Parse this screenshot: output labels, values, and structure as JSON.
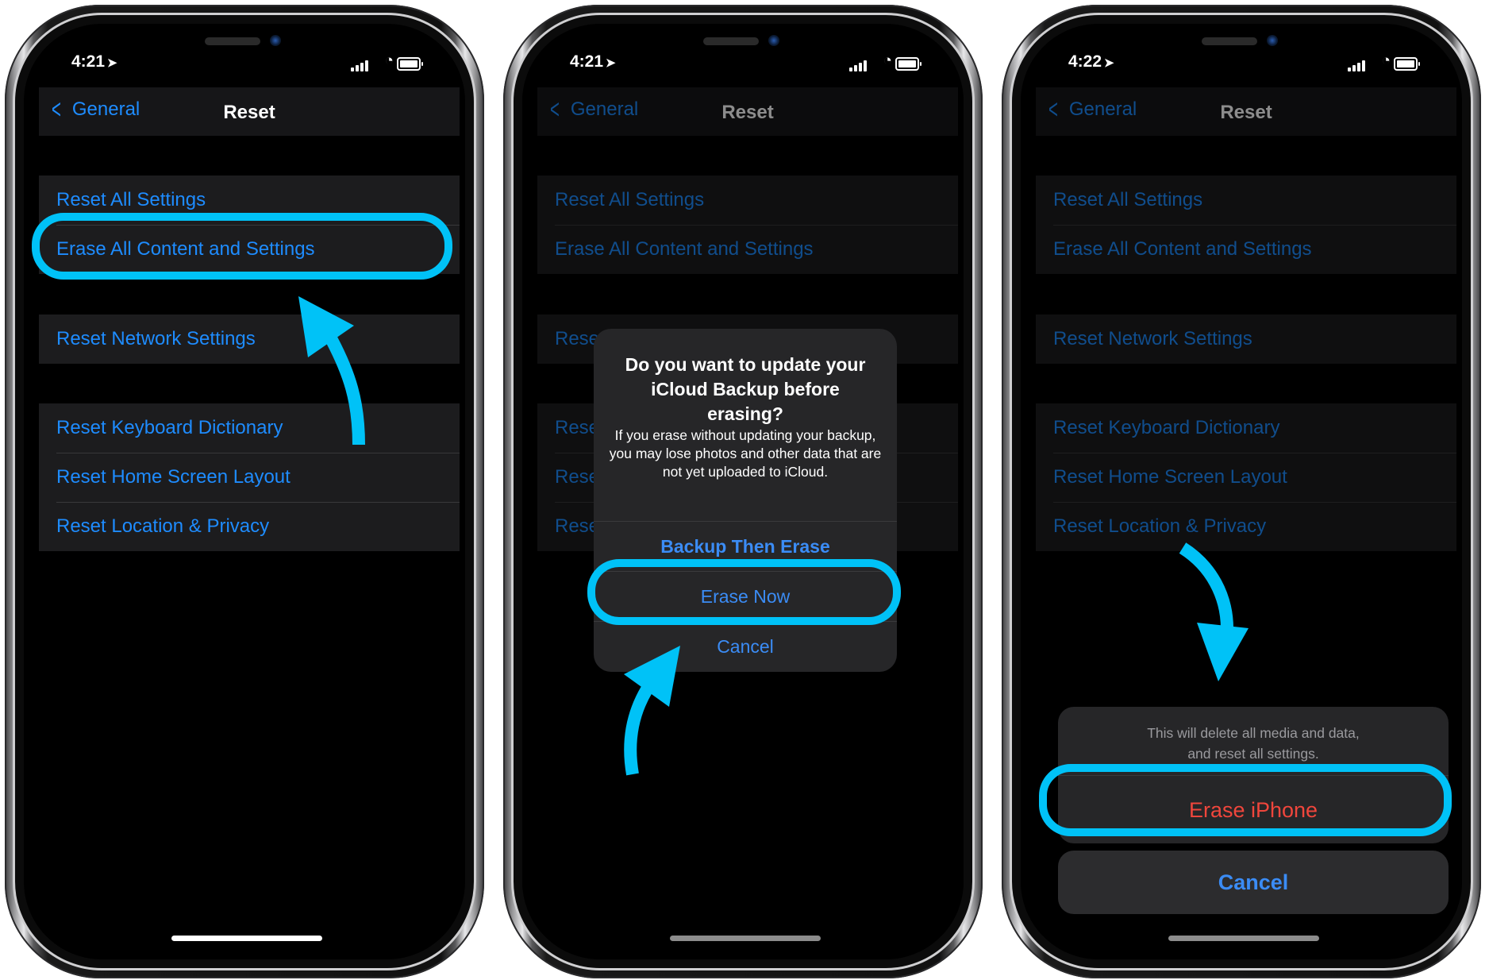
{
  "accent_color": "#00c2f7",
  "link_color": "#1e8cff",
  "destructive_color": "#f0463c",
  "phones": [
    {
      "status": {
        "time": "4:21",
        "location_icon": "location-arrow-icon",
        "signal_icon": "signal-bars-icon",
        "wifi_icon": "wifi-icon",
        "battery_icon": "battery-icon"
      },
      "nav": {
        "back_label": "General",
        "back_icon": "chevron-left-icon",
        "title": "Reset"
      },
      "groups": [
        [
          "Reset All Settings",
          "Erase All Content and Settings"
        ],
        [
          "Reset Network Settings"
        ],
        [
          "Reset Keyboard Dictionary",
          "Reset Home Screen Layout",
          "Reset Location & Privacy"
        ]
      ],
      "highlighted": "Erase All Content and Settings"
    },
    {
      "status": {
        "time": "4:21"
      },
      "nav": {
        "back_label": "General",
        "title": "Reset"
      },
      "groups": [
        [
          "Reset All Settings",
          "Erase All Content and Settings"
        ],
        [
          "Reset Network Settings"
        ],
        [
          "Reset Keyboard Dictionary",
          "Reset Home Screen Layout",
          "Reset Location & Privacy"
        ]
      ],
      "alert": {
        "title": "Do you want to update your iCloud Backup before erasing?",
        "message": "If you erase without updating your backup, you may lose photos and other data that are not yet uploaded to iCloud.",
        "buttons": [
          "Backup Then Erase",
          "Erase Now",
          "Cancel"
        ]
      },
      "highlighted": "Erase Now"
    },
    {
      "status": {
        "time": "4:22"
      },
      "nav": {
        "back_label": "General",
        "title": "Reset"
      },
      "groups": [
        [
          "Reset All Settings",
          "Erase All Content and Settings"
        ],
        [
          "Reset Network Settings"
        ],
        [
          "Reset Keyboard Dictionary",
          "Reset Home Screen Layout",
          "Reset Location & Privacy"
        ]
      ],
      "action_sheet": {
        "message_line1": "This will delete all media and data,",
        "message_line2": "and reset all settings.",
        "destructive_button": "Erase iPhone",
        "cancel_button": "Cancel"
      },
      "highlighted": "Erase iPhone"
    }
  ]
}
